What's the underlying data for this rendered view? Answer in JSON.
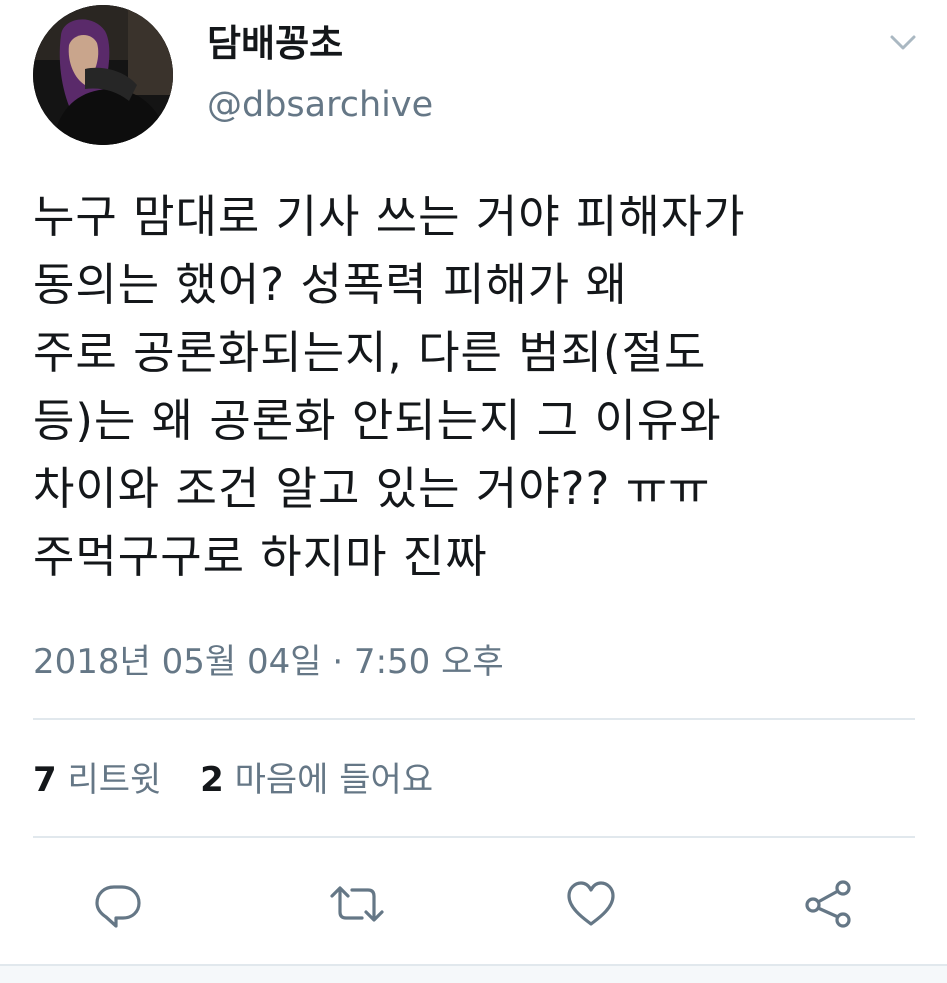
{
  "author": {
    "display_name": "담배꽁초",
    "handle": "@dbsarchive"
  },
  "tweet": {
    "lines": [
      "누구 맘대로 기사 쓰는 거야 피해자가",
      "동의는 했어? 성폭력 피해가 왜",
      "주로 공론화되는지, 다른 범죄(절도",
      "등)는 왜 공론화 안되는지 그 이유와",
      "차이와 조건 알고 있는 거야?? ㅠㅠ",
      "주먹구구로 하지마 진짜"
    ],
    "timestamp": "2018년 05월 04일 · 7:50 오후"
  },
  "stats": {
    "retweets_count": "7",
    "retweets_label": "리트윗",
    "likes_count": "2",
    "likes_label": "마음에 들어요"
  },
  "icons": {
    "menu": "chevron-down-icon",
    "reply": "reply-icon",
    "retweet": "retweet-icon",
    "like": "heart-icon",
    "share": "share-icon"
  },
  "colors": {
    "text_primary": "#14171a",
    "text_secondary": "#657786",
    "icon": "#657786",
    "divider": "#e1e8ed"
  }
}
